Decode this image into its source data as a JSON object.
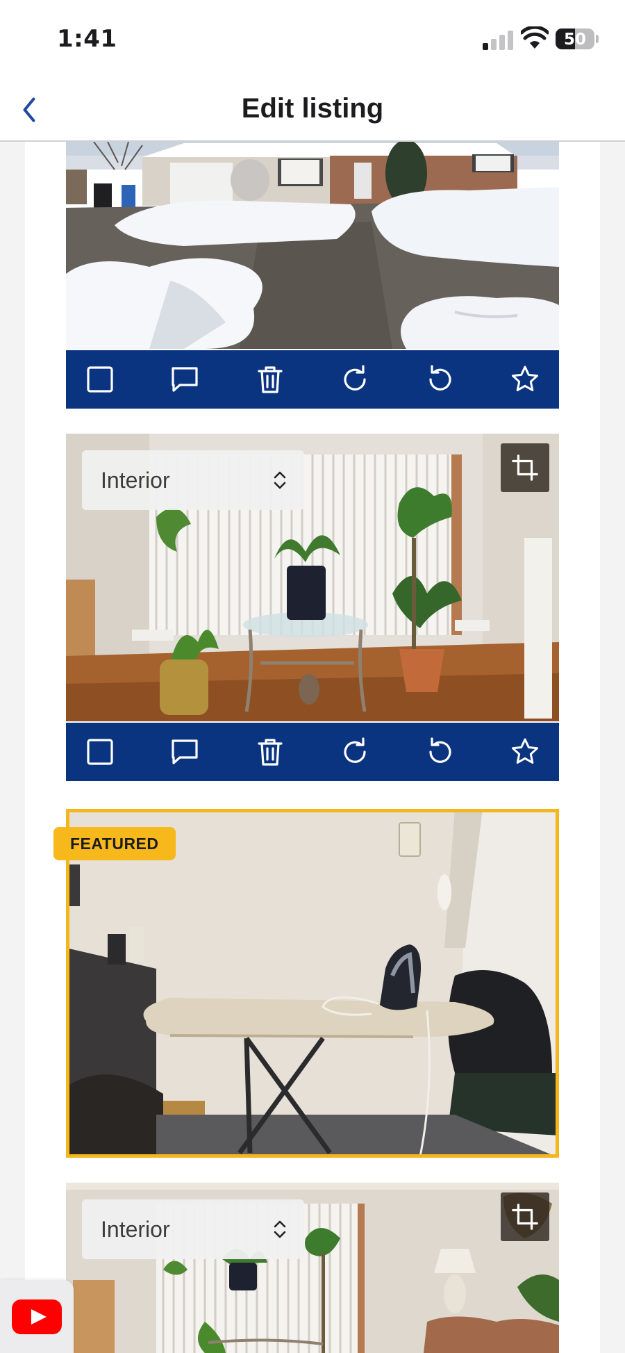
{
  "status_bar": {
    "time": "1:41",
    "battery_percent": "50",
    "signal_bars_active": 1,
    "signal_bars_total": 4
  },
  "header": {
    "title": "Edit listing",
    "back_icon": "chevron-left-icon"
  },
  "photos": [
    {
      "scene": "snowy driveway and house exterior",
      "toolbar_icons": [
        "checkbox-icon",
        "comment-icon",
        "trash-icon",
        "rotate-clockwise-icon",
        "rotate-counterclockwise-icon",
        "star-icon"
      ]
    },
    {
      "scene": "living room window with houseplants and glass table",
      "category": "Interior",
      "crop_icon": "crop-icon",
      "toolbar_icons": [
        "checkbox-icon",
        "comment-icon",
        "trash-icon",
        "rotate-clockwise-icon",
        "rotate-counterclockwise-icon",
        "star-icon"
      ]
    },
    {
      "scene": "ironing board with iron against wall",
      "badge": "FEATURED",
      "featured": true
    },
    {
      "scene": "living room with window, plants and lamp",
      "category": "Interior",
      "crop_icon": "crop-icon"
    }
  ],
  "colors": {
    "toolbar_bg": "#0a3480",
    "featured_accent": "#f4b61d",
    "back_chevron": "#1f4aa0"
  },
  "pip": {
    "icon": "youtube-icon"
  }
}
